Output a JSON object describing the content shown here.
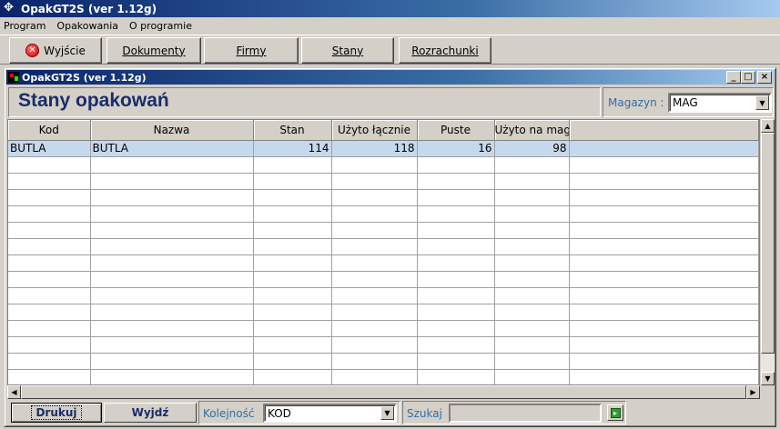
{
  "app": {
    "title": "OpakGT2S (ver 1.12g)"
  },
  "menu": {
    "items": [
      "Program",
      "Opakowania",
      "O programie"
    ]
  },
  "toolbar": {
    "exit_label": "Wyjście",
    "documents_label": "Dokumenty",
    "firms_label": "Firmy",
    "stock_label": "Stany",
    "settlements_label": "Rozrachunki"
  },
  "child_window": {
    "title": "OpakGT2S (ver 1.12g)",
    "minimize": "_",
    "maximize": "□",
    "close": "×"
  },
  "header": {
    "page_title": "Stany opakowań",
    "warehouse_label": "Magazyn :",
    "warehouse_value": "MAG"
  },
  "table": {
    "columns": [
      "Kod",
      "Nazwa",
      "Stan",
      "Użyto łącznie",
      "Puste",
      "Użyto na mag"
    ],
    "rows": [
      {
        "kod": "BUTLA",
        "nazwa": "BUTLA",
        "stan": "114",
        "uzyto_lacznie": "118",
        "puste": "16",
        "uzyto_na_mag": "98"
      }
    ]
  },
  "footer": {
    "print_label": "Drukuj",
    "exit_label": "Wyjdź",
    "order_label": "Kolejność",
    "order_value": "KOD",
    "search_label": "Szukaj",
    "search_value": ""
  }
}
